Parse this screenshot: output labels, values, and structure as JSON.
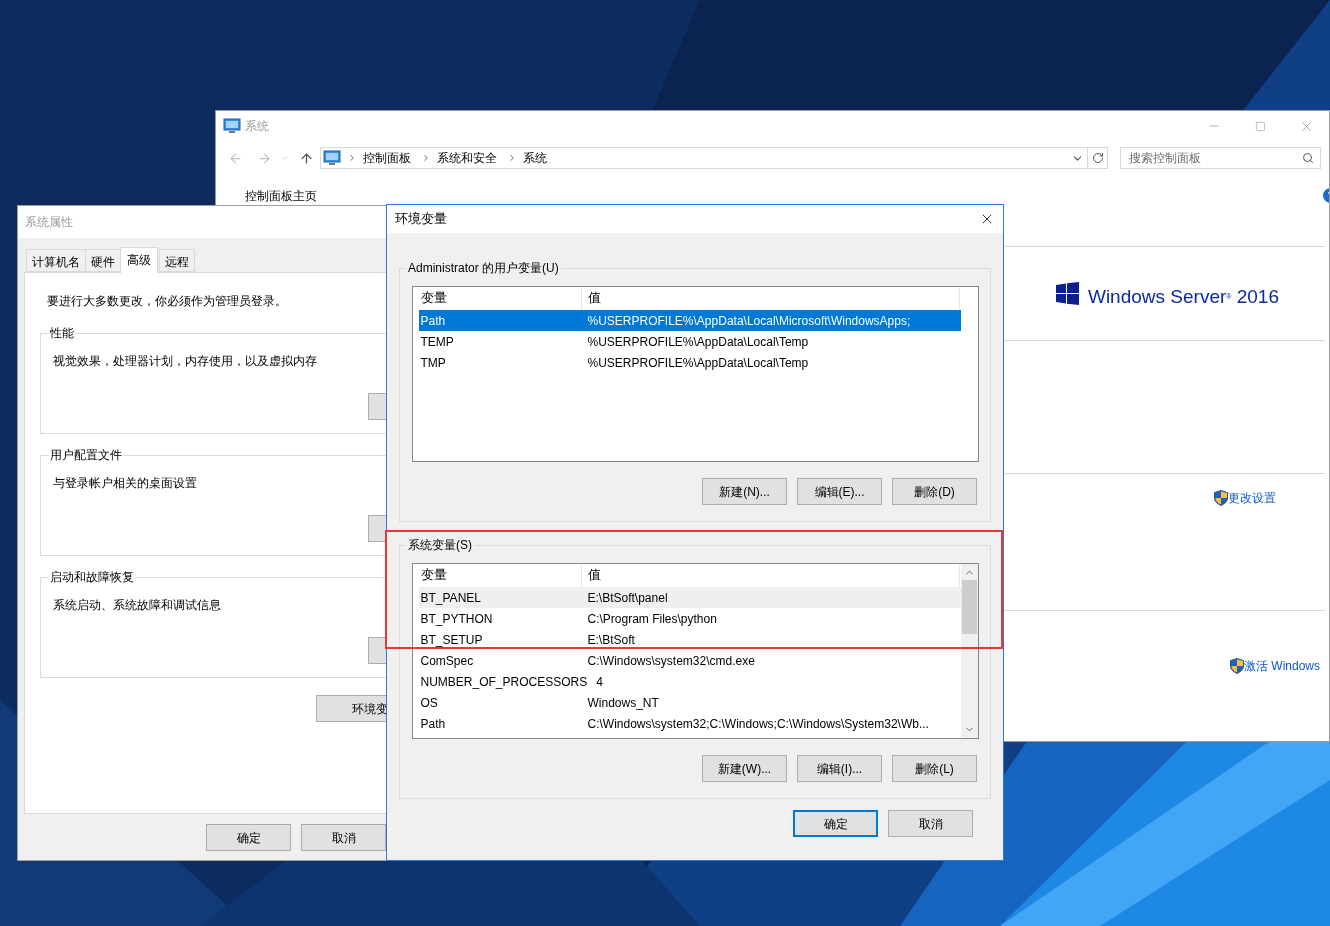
{
  "system_window": {
    "title": "系统",
    "breadcrumbs": [
      "控制面板",
      "系统和安全",
      "系统"
    ],
    "search": {
      "placeholder": "搜索控制面板"
    },
    "nav_link": "控制面板主页",
    "product": "Windows Server$^{®}$ 2016",
    "links": [
      "更改设置",
      "激活 Windows"
    ]
  },
  "system_properties": {
    "title": "系统属性",
    "tabs": [
      {
        "label": "计算机名",
        "selected": false
      },
      {
        "label": "硬件",
        "selected": false
      },
      {
        "label": "高级",
        "selected": true
      },
      {
        "label": "远程",
        "selected": false
      }
    ],
    "notice": "要进行大多数更改，你必须作为管理员登录。",
    "groups": [
      {
        "title": "性能",
        "description": "视觉效果，处理器计划，内存使用，以及虚拟内存"
      },
      {
        "title": "用户配置文件",
        "description": "与登录帐户相关的桌面设置"
      },
      {
        "title": "启动和故障恢复",
        "description": "系统启动、系统故障和调试信息"
      }
    ],
    "env_button": "环境变",
    "buttons": [
      "确定",
      "取消"
    ]
  },
  "env_dialog": {
    "title": "环境变量",
    "user_vars": {
      "title": "Administrator 的用户变量(U)",
      "columns": [
        "变量",
        "值"
      ],
      "rows": [
        {
          "name": "Path",
          "value": "%USERPROFILE%\\AppData\\Local\\Microsoft\\WindowsApps;",
          "selected": true,
          "hovered": false
        },
        {
          "name": "TEMP",
          "value": "%USERPROFILE%\\AppData\\Local\\Temp",
          "selected": false,
          "hovered": false
        },
        {
          "name": "TMP",
          "value": "%USERPROFILE%\\AppData\\Local\\Temp",
          "selected": false,
          "hovered": false
        }
      ],
      "buttons": [
        "新建(N)...",
        "编辑(E)...",
        "删除(D)"
      ]
    },
    "system_vars": {
      "title": "系统变量(S)",
      "columns": [
        "变量",
        "值"
      ],
      "rows": [
        {
          "name": "BT_PANEL",
          "value": "E:\\BtSoft\\panel",
          "selected": false,
          "hovered": true
        },
        {
          "name": "BT_PYTHON",
          "value": "C:\\Program Files\\python",
          "selected": false,
          "hovered": false
        },
        {
          "name": "BT_SETUP",
          "value": "E:\\BtSoft",
          "selected": false,
          "hovered": false
        },
        {
          "name": "ComSpec",
          "value": "C:\\Windows\\system32\\cmd.exe",
          "selected": false,
          "hovered": false
        },
        {
          "name": "NUMBER_OF_PROCESSORS",
          "value": "4",
          "selected": false,
          "hovered": false
        },
        {
          "name": "OS",
          "value": "Windows_NT",
          "selected": false,
          "hovered": false
        },
        {
          "name": "Path",
          "value": "C:\\Windows\\system32;C:\\Windows;C:\\Windows\\System32\\Wb...",
          "selected": false,
          "hovered": false
        }
      ],
      "buttons": [
        "新建(W)...",
        "编辑(I)...",
        "删除(L)"
      ]
    },
    "buttons": [
      {
        "label": "确定",
        "default": true
      },
      {
        "label": "取消",
        "default": false
      }
    ]
  }
}
